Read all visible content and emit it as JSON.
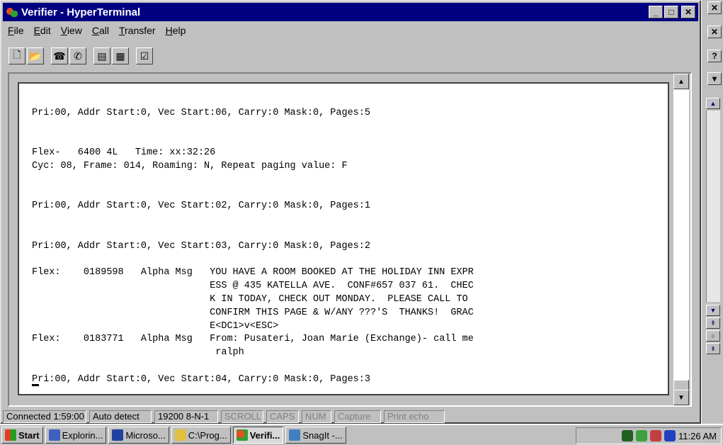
{
  "window": {
    "title": "Verifier - HyperTerminal"
  },
  "menu": [
    {
      "label": "File",
      "key": "F",
      "rest": "ile"
    },
    {
      "label": "Edit",
      "key": "E",
      "rest": "dit"
    },
    {
      "label": "View",
      "key": "V",
      "rest": "iew"
    },
    {
      "label": "Call",
      "key": "C",
      "rest": "all"
    },
    {
      "label": "Transfer",
      "key": "T",
      "rest": "ransfer"
    },
    {
      "label": "Help",
      "key": "H",
      "rest": "elp"
    }
  ],
  "toolbar": [
    "new-icon",
    "open-icon",
    "connect-icon",
    "disconnect-icon",
    "send-icon",
    "receive-icon",
    "properties-icon"
  ],
  "terminal": {
    "text": "\nPri:00, Addr Start:0, Vec Start:06, Carry:0 Mask:0, Pages:5\n\n\nFlex-   6400 4L   Time: xx:32:26\nCyc: 08, Frame: 014, Roaming: N, Repeat paging value: F\n\n\nPri:00, Addr Start:0, Vec Start:02, Carry:0 Mask:0, Pages:1\n\n\nPri:00, Addr Start:0, Vec Start:03, Carry:0 Mask:0, Pages:2\n\nFlex:    0189598   Alpha Msg   YOU HAVE A ROOM BOOKED AT THE HOLIDAY INN EXPR\n                               ESS @ 435 KATELLA AVE.  CONF#657 037 61.  CHEC\n                               K IN TODAY, CHECK OUT MONDAY.  PLEASE CALL TO\n                               CONFIRM THIS PAGE & W/ANY ???'S  THANKS!  GRAC\n                               E<DC1>v<ESC>\nFlex:    0183771   Alpha Msg   From: Pusateri, Joan Marie (Exchange)- call me\n                                ralph\n\nPri:00, Addr Start:0, Vec Start:04, Carry:0 Mask:0, Pages:3"
  },
  "status": {
    "connected": "Connected 1:59:00",
    "detect": "Auto detect",
    "settings": "19200 8-N-1",
    "scroll": "SCROLL",
    "caps": "CAPS",
    "num": "NUM",
    "capture": "Capture",
    "echo": "Print echo"
  },
  "taskbar": {
    "start": "Start",
    "items": [
      "Explorin...",
      "Microso...",
      "C:\\Prog...",
      "Verifi...",
      "SnagIt -..."
    ],
    "clock": "11:26 AM"
  },
  "colors": {
    "titlebar": "#000080",
    "face": "#c0c0c0"
  }
}
